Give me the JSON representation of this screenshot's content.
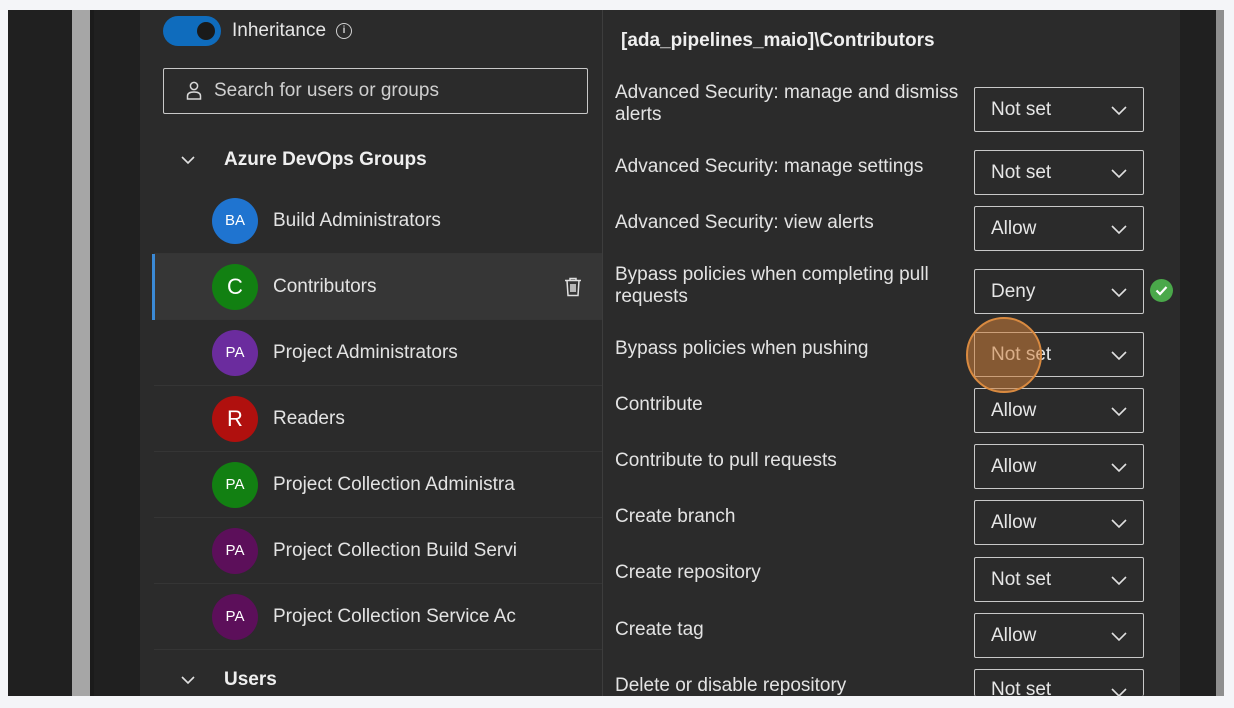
{
  "inheritance": {
    "label": "Inheritance",
    "enabled": true
  },
  "search": {
    "placeholder": "Search for users or groups",
    "value": ""
  },
  "groups": [
    {
      "title": "Azure DevOps Groups",
      "expanded": true,
      "members": [
        {
          "initials": "BA",
          "name": "Build Administrators",
          "color": "#1f74d0",
          "selected": false
        },
        {
          "initials": "C",
          "name": "Contributors",
          "color": "#128012",
          "selected": true
        },
        {
          "initials": "PA",
          "name": "Project Administrators",
          "color": "#6b2c9e",
          "selected": false
        },
        {
          "initials": "R",
          "name": "Readers",
          "color": "#b0100e",
          "selected": false
        },
        {
          "initials": "PA",
          "name": "Project Collection Administra",
          "color": "#128012",
          "selected": false
        },
        {
          "initials": "PA",
          "name": "Project Collection Build Servi",
          "color": "#5c0f5a",
          "selected": false
        },
        {
          "initials": "PA",
          "name": "Project Collection Service Ac",
          "color": "#5c0f5a",
          "selected": false
        }
      ]
    },
    {
      "title": "Users",
      "expanded": true,
      "members": []
    }
  ],
  "permissions": {
    "title": "[ada_pipelines_maio]\\Contributors",
    "items": [
      {
        "label": "Advanced Security: manage and dismiss alerts",
        "value": "Not set"
      },
      {
        "label": "Advanced Security: manage settings",
        "value": "Not set"
      },
      {
        "label": "Advanced Security: view alerts",
        "value": "Allow"
      },
      {
        "label": "Bypass policies when completing pull requests",
        "value": "Deny"
      },
      {
        "label": "Bypass policies when pushing",
        "value": "Not set"
      },
      {
        "label": "Contribute",
        "value": "Allow"
      },
      {
        "label": "Contribute to pull requests",
        "value": "Allow"
      },
      {
        "label": "Create branch",
        "value": "Allow"
      },
      {
        "label": "Create repository",
        "value": "Not set"
      },
      {
        "label": "Create tag",
        "value": "Allow"
      },
      {
        "label": "Delete or disable repository",
        "value": "Not set"
      }
    ]
  },
  "icons": {
    "info": "info-icon",
    "search": "person-icon",
    "delete": "trash-icon",
    "dropdown": "chevron-down-icon",
    "saved": "check-circle-icon"
  },
  "colors": {
    "accent": "#0f6cbd",
    "selection": "#3b8ad6",
    "success": "#4aa84a"
  }
}
